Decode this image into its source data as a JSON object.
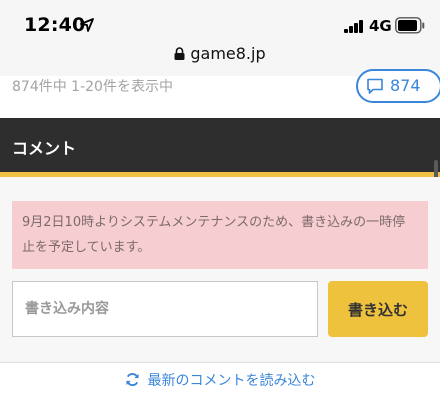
{
  "status_bar": {
    "time": "12:40",
    "network": "4G",
    "icons": [
      "location-arrow-icon",
      "signal-icon",
      "battery-icon"
    ]
  },
  "url_bar": {
    "domain": "game8.jp",
    "icon": "lock-icon"
  },
  "comments_summary": {
    "range_text": "874件中 1-20件を表示中",
    "badge_count": "874",
    "badge_icon": "chat-bubble-icon"
  },
  "comment_section": {
    "title": "コメント",
    "notice": "9月2日10時よりシステムメンテナンスのため、書き込みの一時停止を予定しています。",
    "input_placeholder": "書き込み内容",
    "input_value": "",
    "write_button_label": "書き込む",
    "reload_label": "最新のコメントを読み込む",
    "reload_icon": "refresh-icon"
  },
  "colors": {
    "accent_blue": "#3a86d9",
    "header_dark": "#2e2e2e",
    "accent_yellow": "#efc23d",
    "notice_pink": "#f6cdd1"
  }
}
